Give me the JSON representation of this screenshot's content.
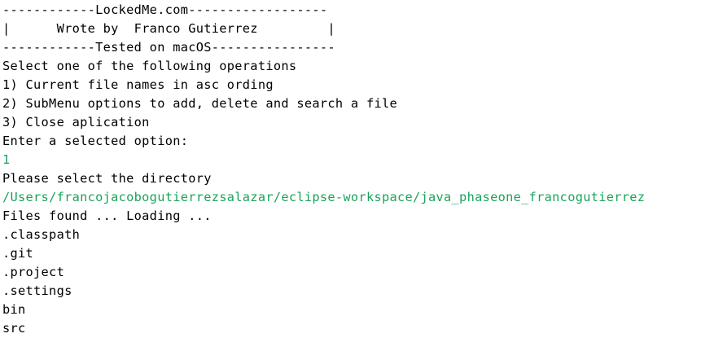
{
  "console": {
    "lines": [
      {
        "text": "------------LockedMe.com------------------",
        "kind": "output"
      },
      {
        "text": "|      Wrote by  Franco Gutierrez         |",
        "kind": "output"
      },
      {
        "text": "------------Tested on macOS----------------",
        "kind": "output"
      },
      {
        "text": "Select one of the following operations",
        "kind": "output"
      },
      {
        "text": "1) Current file names in asc ording",
        "kind": "output"
      },
      {
        "text": "2) SubMenu options to add, delete and search a file",
        "kind": "output"
      },
      {
        "text": "3) Close aplication",
        "kind": "output"
      },
      {
        "text": "Enter a selected option:",
        "kind": "output"
      },
      {
        "text": "1",
        "kind": "input"
      },
      {
        "text": "Please select the directory",
        "kind": "output"
      },
      {
        "text": "/Users/francojacobogutierrezsalazar/eclipse-workspace/java_phaseone_francogutierrez",
        "kind": "input"
      },
      {
        "text": "Files found ... Loading ...",
        "kind": "output"
      },
      {
        "text": ".classpath",
        "kind": "output"
      },
      {
        "text": ".git",
        "kind": "output"
      },
      {
        "text": ".project",
        "kind": "output"
      },
      {
        "text": ".settings",
        "kind": "output"
      },
      {
        "text": "bin",
        "kind": "output"
      },
      {
        "text": "src",
        "kind": "output"
      }
    ],
    "colors": {
      "output": "#000000",
      "input": "#1aa35a",
      "background": "#ffffff"
    }
  }
}
